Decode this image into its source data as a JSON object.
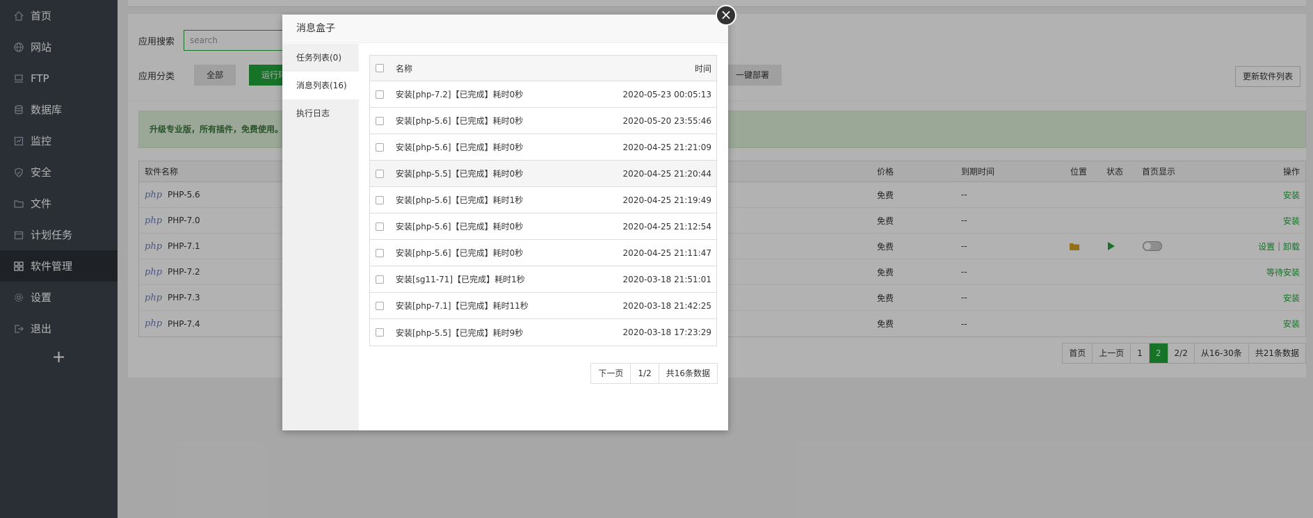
{
  "sidebar": {
    "items": [
      {
        "label": "首页",
        "icon": "home-icon"
      },
      {
        "label": "网站",
        "icon": "globe-icon"
      },
      {
        "label": "FTP",
        "icon": "ftp-icon"
      },
      {
        "label": "数据库",
        "icon": "database-icon"
      },
      {
        "label": "监控",
        "icon": "monitor-icon"
      },
      {
        "label": "安全",
        "icon": "shield-icon"
      },
      {
        "label": "文件",
        "icon": "folder-icon"
      },
      {
        "label": "计划任务",
        "icon": "calendar-icon"
      },
      {
        "label": "软件管理",
        "icon": "grid-icon"
      },
      {
        "label": "设置",
        "icon": "gear-icon"
      },
      {
        "label": "退出",
        "icon": "logout-icon"
      }
    ],
    "plus": "+"
  },
  "toolbar": {
    "search_label": "应用搜索",
    "search_placeholder": "search",
    "category_label": "应用分类",
    "cat_all": "全部",
    "cat_runtime": "运行环",
    "cat_deploy": "一键部署",
    "update_btn": "更新软件列表"
  },
  "promo": "升级专业版，所有插件，免费使用。",
  "software_table": {
    "headers": {
      "name": "软件名称",
      "price": "价格",
      "expire": "到期时间",
      "location": "位置",
      "status": "状态",
      "home": "首页显示",
      "action": "操作"
    },
    "rows": [
      {
        "php": "php",
        "name": "PHP-5.6",
        "price": "免费",
        "expire": "--",
        "action": "安装"
      },
      {
        "php": "php",
        "name": "PHP-7.0",
        "price": "免费",
        "expire": "--",
        "action": "安装"
      },
      {
        "php": "php",
        "name": "PHP-7.1",
        "price": "免费",
        "expire": "--",
        "action_setting": "设置",
        "action_sep": "|",
        "action_uninstall": "卸载"
      },
      {
        "php": "php",
        "name": "PHP-7.2",
        "price": "免费",
        "expire": "--",
        "action": "等待安装"
      },
      {
        "php": "php",
        "name": "PHP-7.3",
        "price": "免费",
        "expire": "--",
        "action": "安装"
      },
      {
        "php": "php",
        "name": "PHP-7.4",
        "price": "免费",
        "expire": "--",
        "action": "安装"
      }
    ]
  },
  "pager": {
    "first": "首页",
    "prev": "上一页",
    "p1": "1",
    "p2": "2",
    "pages": "2/2",
    "range": "从16-30条",
    "total": "共21条数据"
  },
  "modal": {
    "title": "消息盒子",
    "tabs": [
      "任务列表(0)",
      "消息列表(16)",
      "执行日志"
    ],
    "col_name": "名称",
    "col_time": "时间",
    "rows": [
      {
        "name": "安装[php-7.2]【已完成】耗时0秒",
        "time": "2020-05-23 00:05:13"
      },
      {
        "name": "安装[php-5.6]【已完成】耗时0秒",
        "time": "2020-05-20 23:55:46"
      },
      {
        "name": "安装[php-5.6]【已完成】耗时0秒",
        "time": "2020-04-25 21:21:09"
      },
      {
        "name": "安装[php-5.5]【已完成】耗时0秒",
        "time": "2020-04-25 21:20:44"
      },
      {
        "name": "安装[php-5.6]【已完成】耗时1秒",
        "time": "2020-04-25 21:19:49"
      },
      {
        "name": "安装[php-5.6]【已完成】耗时0秒",
        "time": "2020-04-25 21:12:54"
      },
      {
        "name": "安装[php-5.6]【已完成】耗时0秒",
        "time": "2020-04-25 21:11:47"
      },
      {
        "name": "安装[sg11-71]【已完成】耗时1秒",
        "time": "2020-03-18 21:51:01"
      },
      {
        "name": "安装[php-7.1]【已完成】耗时11秒",
        "time": "2020-03-18 21:42:25"
      },
      {
        "name": "安装[php-5.5]【已完成】耗时9秒",
        "time": "2020-03-18 17:23:29"
      }
    ],
    "pager": {
      "next": "下一页",
      "pages": "1/2",
      "total": "共16条数据"
    },
    "close": "×"
  }
}
